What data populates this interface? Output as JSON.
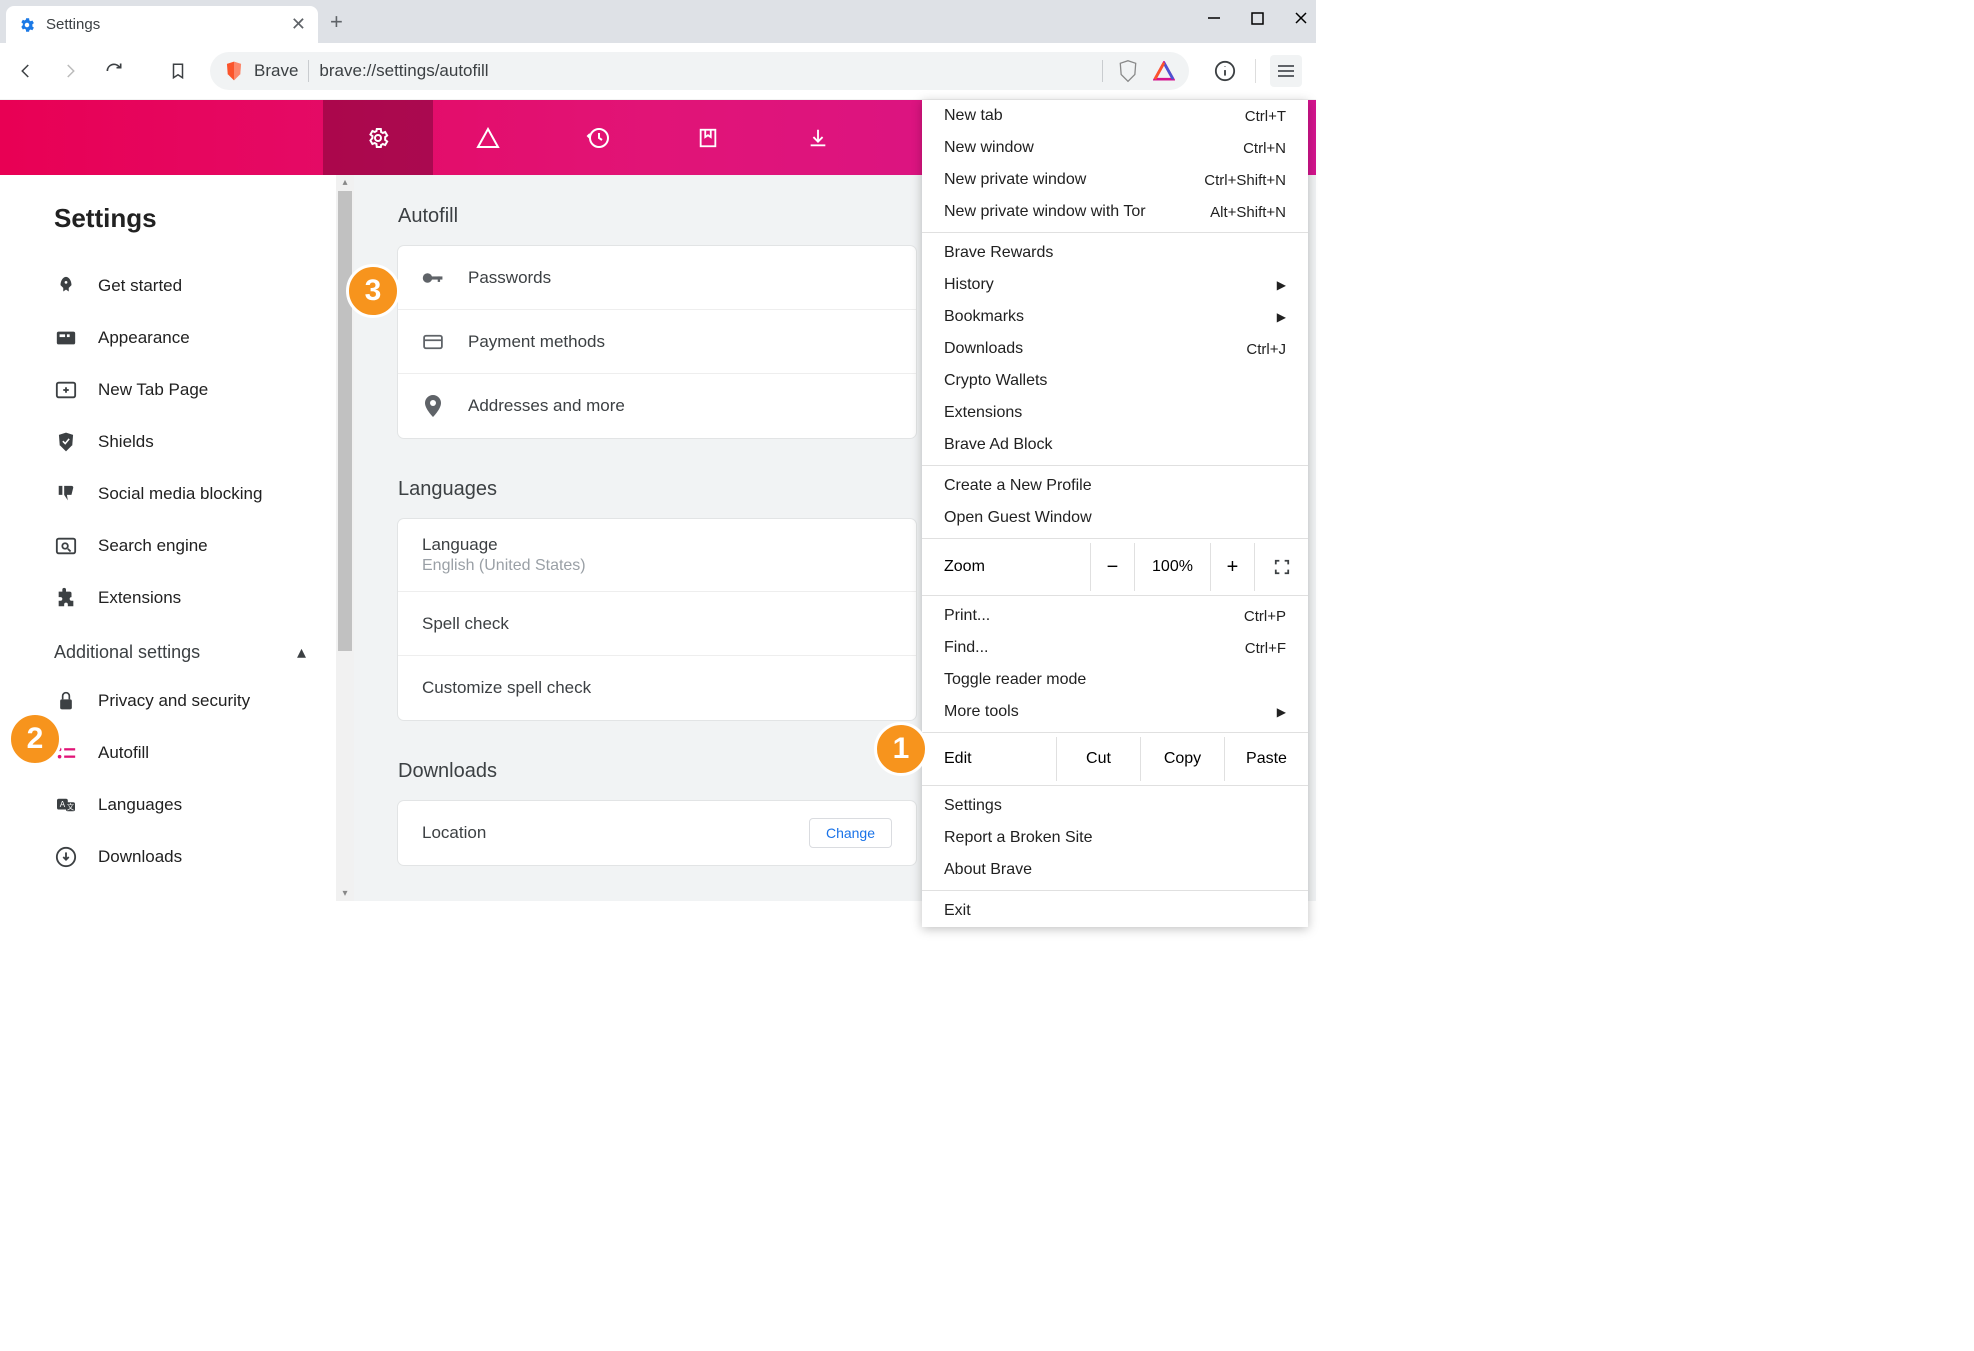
{
  "window": {
    "tab_title": "Settings"
  },
  "toolbar": {
    "brave_label": "Brave",
    "url": "brave://settings/autofill"
  },
  "sidebar": {
    "title": "Settings",
    "items": [
      {
        "label": "Get started"
      },
      {
        "label": "Appearance"
      },
      {
        "label": "New Tab Page"
      },
      {
        "label": "Shields"
      },
      {
        "label": "Social media blocking"
      },
      {
        "label": "Search engine"
      },
      {
        "label": "Extensions"
      }
    ],
    "additional_heading": "Additional settings",
    "sub_items": [
      {
        "label": "Privacy and security"
      },
      {
        "label": "Autofill"
      },
      {
        "label": "Languages"
      },
      {
        "label": "Downloads"
      }
    ]
  },
  "sections": {
    "autofill": {
      "title": "Autofill",
      "rows": [
        {
          "label": "Passwords"
        },
        {
          "label": "Payment methods"
        },
        {
          "label": "Addresses and more"
        }
      ]
    },
    "languages": {
      "title": "Languages",
      "language_label": "Language",
      "language_value": "English (United States)",
      "spellcheck": "Spell check",
      "customize": "Customize spell check"
    },
    "downloads": {
      "title": "Downloads",
      "location_label": "Location",
      "change": "Change"
    }
  },
  "menu": {
    "new_tab": "New tab",
    "new_tab_k": "Ctrl+T",
    "new_window": "New window",
    "new_window_k": "Ctrl+N",
    "new_private": "New private window",
    "new_private_k": "Ctrl+Shift+N",
    "new_tor": "New private window with Tor",
    "new_tor_k": "Alt+Shift+N",
    "rewards": "Brave Rewards",
    "history": "History",
    "bookmarks": "Bookmarks",
    "downloads": "Downloads",
    "downloads_k": "Ctrl+J",
    "crypto": "Crypto Wallets",
    "extensions": "Extensions",
    "adblock": "Brave Ad Block",
    "new_profile": "Create a New Profile",
    "guest": "Open Guest Window",
    "zoom": "Zoom",
    "zoom_minus": "−",
    "zoom_val": "100%",
    "zoom_plus": "+",
    "print": "Print...",
    "print_k": "Ctrl+P",
    "find": "Find...",
    "find_k": "Ctrl+F",
    "reader": "Toggle reader mode",
    "more_tools": "More tools",
    "edit": "Edit",
    "cut": "Cut",
    "copy": "Copy",
    "paste": "Paste",
    "settings": "Settings",
    "report": "Report a Broken Site",
    "about": "About Brave",
    "exit": "Exit"
  },
  "badges": {
    "one": "1",
    "two": "2",
    "three": "3"
  }
}
